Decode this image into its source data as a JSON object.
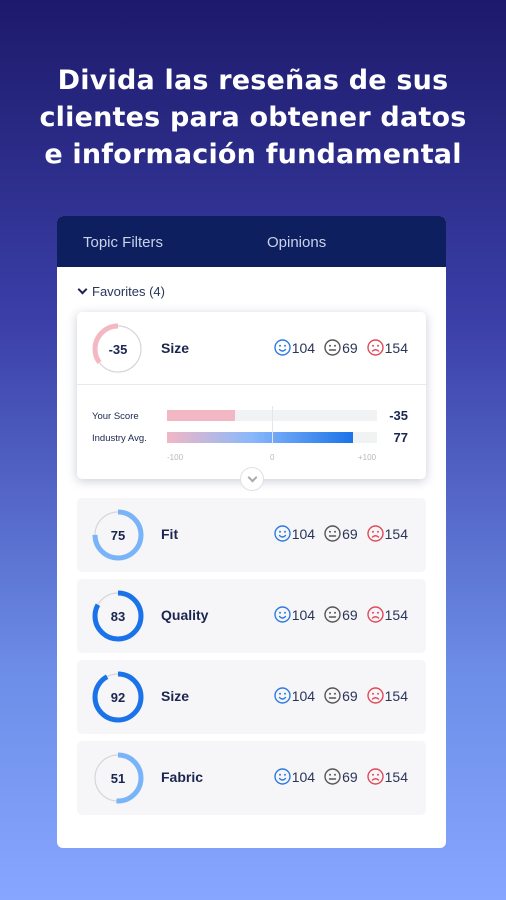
{
  "headline": [
    "Divida las reseñas de sus",
    "clientes para obtener datos",
    "e información fundamental"
  ],
  "tabs": [
    {
      "label": "Topic Filters"
    },
    {
      "label": "Opinions"
    }
  ],
  "favorites_label": "Favorites (4)",
  "colors": {
    "positive": "#2f7ae0",
    "neutral": "#555555",
    "negative": "#e04a5a",
    "ring_negative": "#f4b8c2",
    "ring_light": "#7ab4f8",
    "ring_dark": "#1a73e8",
    "header": "#0d1f5e"
  },
  "expanded": {
    "score": "-35",
    "score_value": -35,
    "topic": "Size",
    "positive": "104",
    "neutral": "69",
    "negative": "154",
    "your_score_label": "Your Score",
    "your_score": "-35",
    "your_score_value": -35,
    "industry_label": "Industry Avg.",
    "industry": "77",
    "industry_value": 77,
    "axis": [
      "-100",
      "0",
      "+100"
    ]
  },
  "rows": [
    {
      "score": "75",
      "value": 75,
      "topic": "Fit",
      "positive": "104",
      "neutral": "69",
      "negative": "154"
    },
    {
      "score": "83",
      "value": 83,
      "topic": "Quality",
      "positive": "104",
      "neutral": "69",
      "negative": "154"
    },
    {
      "score": "92",
      "value": 92,
      "topic": "Size",
      "positive": "104",
      "neutral": "69",
      "negative": "154"
    },
    {
      "score": "51",
      "value": 51,
      "topic": "Fabric",
      "positive": "104",
      "neutral": "69",
      "negative": "154"
    }
  ]
}
